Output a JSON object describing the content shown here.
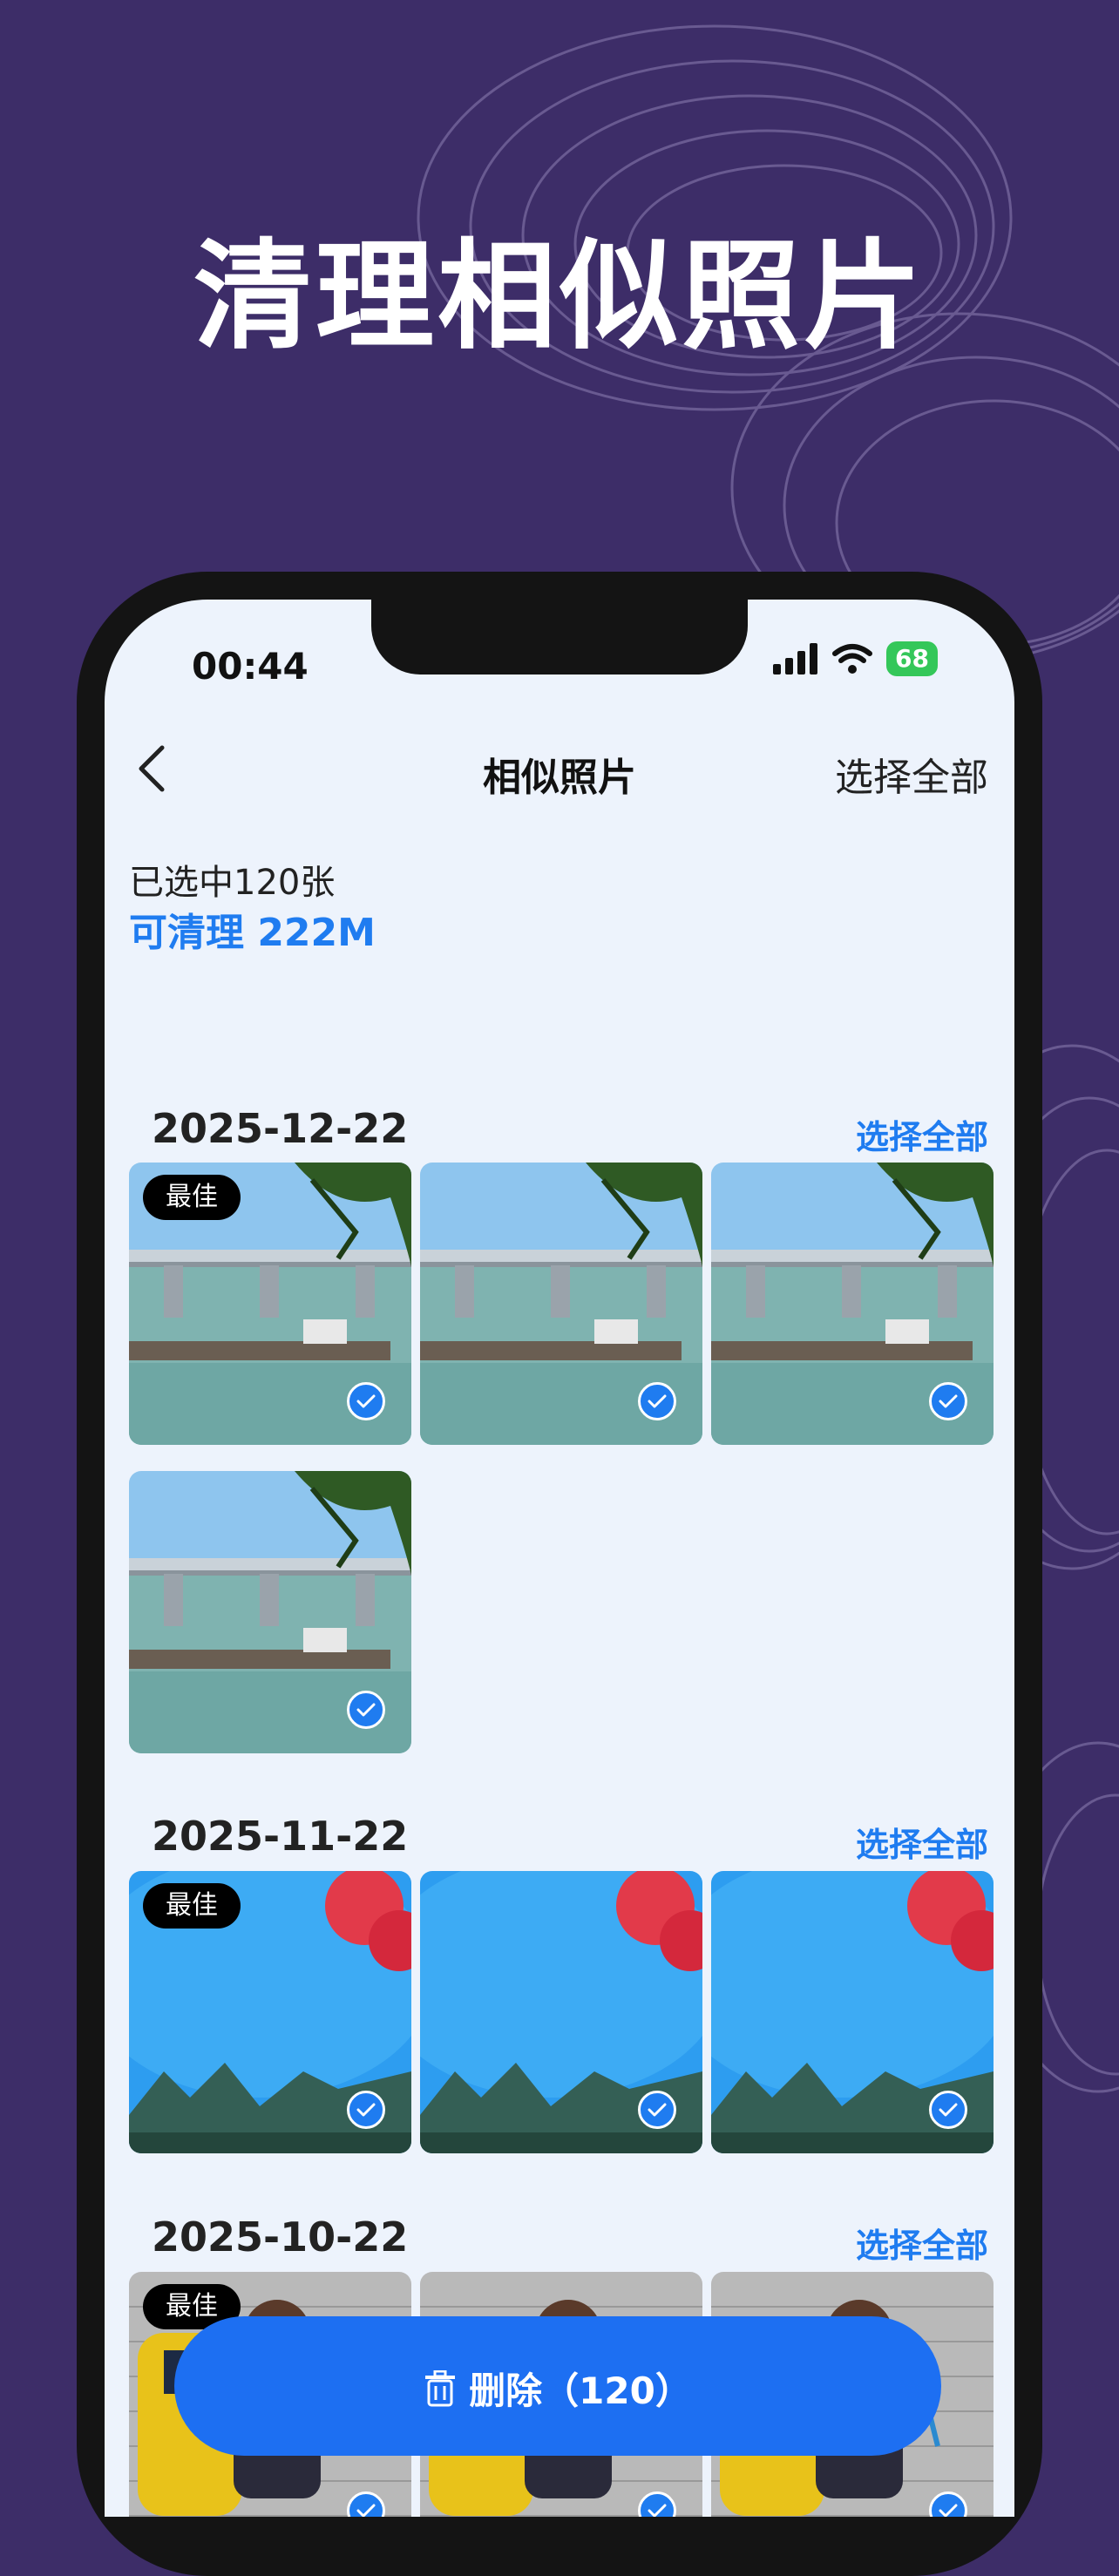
{
  "headline": "清理相似照片",
  "status": {
    "time": "00:44",
    "battery": "68"
  },
  "nav": {
    "title": "相似照片",
    "select_all": "选择全部"
  },
  "summary": {
    "selected": "已选中120张",
    "cleanable": "可清理 222M"
  },
  "sections": [
    {
      "date": "2025-12-22",
      "select_all": "选择全部",
      "count": 4,
      "scene": "bridge",
      "best_label": "最佳"
    },
    {
      "date": "2025-11-22",
      "select_all": "选择全部",
      "count": 3,
      "scene": "sky",
      "best_label": "最佳"
    },
    {
      "date": "2025-10-22",
      "select_all": "选择全部",
      "count": 3,
      "scene": "hiker",
      "best_label": "最佳"
    }
  ],
  "delete_button": {
    "label": "删除（120）"
  },
  "colors": {
    "accent": "#1f7cf0",
    "background": "#3d2d68",
    "screen": "#edf3fc"
  },
  "icons": [
    "back-icon",
    "signal-icon",
    "wifi-icon",
    "battery-icon",
    "check-icon",
    "trash-icon"
  ]
}
